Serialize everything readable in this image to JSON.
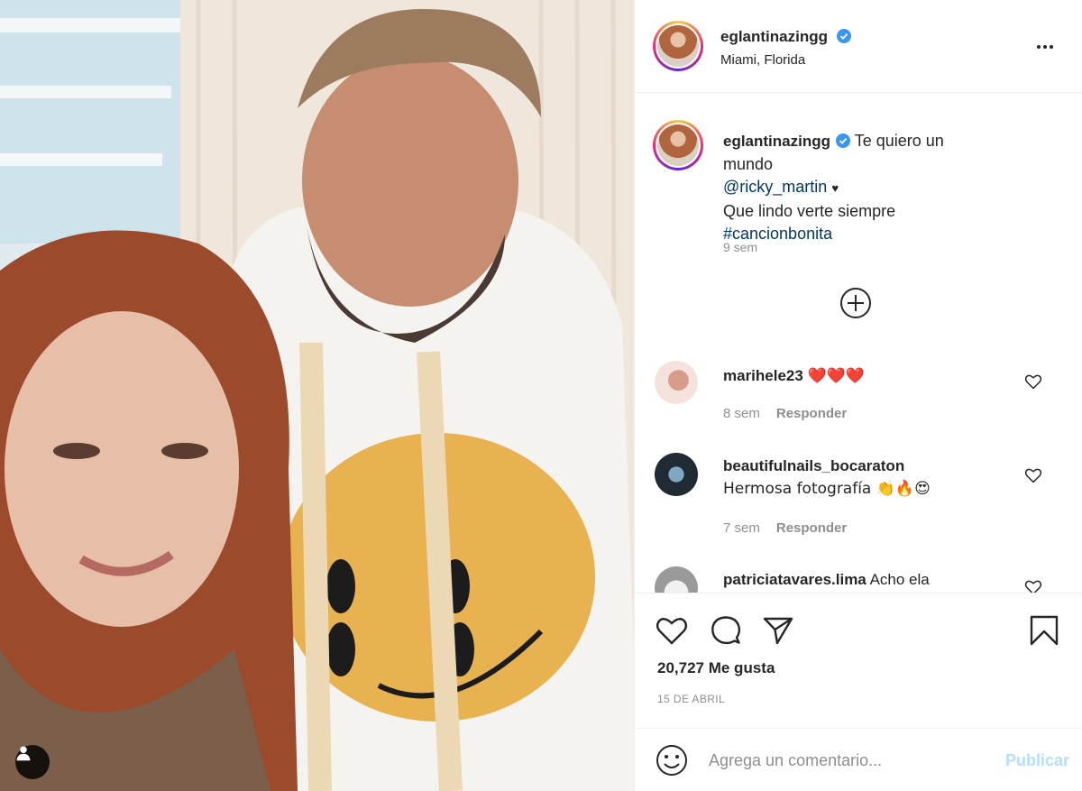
{
  "post": {
    "author": "eglantinazingg",
    "location": "Miami, Florida",
    "caption": {
      "text": "Te quiero un mundo",
      "mention": "@ricky_martin",
      "mention_suffix": "♥",
      "line2": "Que lindo verte siempre",
      "hashtag": "#cancionbonita",
      "time": "9 sem"
    },
    "likes": "20,727 Me gusta",
    "date": "15 DE ABRIL"
  },
  "comments": [
    {
      "user": "marihele23",
      "text": "❤️❤️❤️",
      "time": "8 sem",
      "reply": "Responder"
    },
    {
      "user": "beautifulnails_bocaraton",
      "text": "Hermosa fotografía 👏🔥😍",
      "time": "7 sem",
      "reply": "Responder"
    },
    {
      "user": "patriciatavares.lima",
      "text": "Acho ela"
    }
  ],
  "add_comment": {
    "placeholder": "Agrega un comentario...",
    "publish": "Publicar"
  },
  "icons": {
    "verified": "verified-badge-icon",
    "more": "more-options-icon",
    "load_more": "plus-circle-icon",
    "like": "heart-icon",
    "comment": "comment-icon",
    "share": "share-icon",
    "save": "bookmark-icon",
    "emoji": "emoji-icon",
    "user_tag": "user-tag-icon"
  },
  "colors": {
    "accent": "#0095f6",
    "verified": "#3897f0",
    "link": "#00376b",
    "muted": "#8e8e8e",
    "publish_disabled": "#b2dffc"
  }
}
